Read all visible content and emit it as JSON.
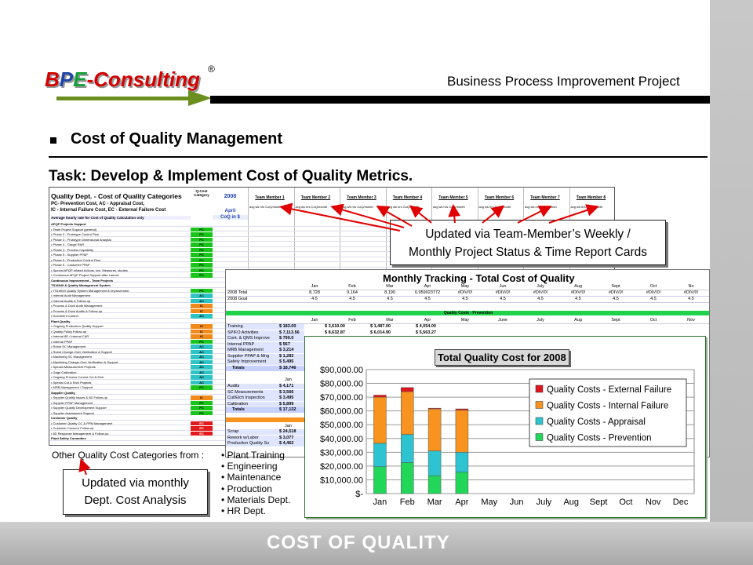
{
  "header": {
    "logo_b": "B",
    "logo_p": "P",
    "logo_e": "E",
    "logo_rest": "-Consulting",
    "registered": "®",
    "project_title": "Business Process Improvement Project"
  },
  "section": {
    "title": "Cost of Quality Management",
    "task": "Task: Develop & Implement Cost of Quality Metrics."
  },
  "sheet": {
    "title": "Quality Dept. - Cost of Quality Categories",
    "legend_line1": "PC- Prevention Cost,          AC - Appraisal Cost,",
    "legend_line2": "IC - Internal Failure Cost,    EC - External Failure Cost",
    "rate_line": "Average hourly rate for Cost of Quality Calculation only",
    "category_header": "Q-Cost Category",
    "year": "2008",
    "month": "April",
    "coq_label": "CoQ in $",
    "team_members": [
      "Team Member 1",
      "Team Member 2",
      "Team Member 3",
      "Team Member 4",
      "Team Member 5",
      "Team Member 6",
      "Team Member 7",
      "Team Member 8"
    ],
    "tm_sub": "avg wk hrs   CoQ/month",
    "rows": [
      {
        "label": "APQP Projects Support",
        "cat": "",
        "bold": true
      },
      {
        "label": "• Team Project Support (general)",
        "cat": "PC"
      },
      {
        "label": "• Phase 3 - Prototype Control Plan",
        "cat": "PC"
      },
      {
        "label": "• Phase 3 - Prototype Dimensional Analysis",
        "cat": "PC"
      },
      {
        "label": "• Phase 4 - Gauge R&R",
        "cat": "PC"
      },
      {
        "label": "• Phase 4 - Process Capability",
        "cat": "PC"
      },
      {
        "label": "• Phase 5 - Supplier PPAP",
        "cat": "PC"
      },
      {
        "label": "• Phase 5 - Production Control Plan",
        "cat": "PC"
      },
      {
        "label": "• Phase 5 - Customer PPAP",
        "cat": "PC"
      },
      {
        "label": "• Special APQP related Actions, incl. Measures, studies",
        "cat": "PC"
      },
      {
        "label": "• Continuous APQP Project Support after Launch",
        "cat": "PC"
      },
      {
        "label": "Continuous Improvement - Team Projects",
        "cat": "",
        "bold": true
      },
      {
        "label": "TS16949 & Quality Management System",
        "cat": "",
        "bold": true
      },
      {
        "label": "• TS16949 Quality System Management & Improvement",
        "cat": "PC"
      },
      {
        "label": "• Internal Audit Management",
        "cat": "AC"
      },
      {
        "label": "• Internal Audits & Follow-up",
        "cat": "AC"
      },
      {
        "label": "• Process & Dock Audit Management",
        "cat": "IC"
      },
      {
        "label": "• Process & Dock Audits & Follow-up",
        "cat": "IC"
      },
      {
        "label": "• Document Control",
        "cat": "AC"
      },
      {
        "label": "Plant Quality",
        "cat": "",
        "bold": true
      },
      {
        "label": "• Ongoing Production Quality Support",
        "cat": "IC"
      },
      {
        "label": "• Quality Policy Follow-up",
        "cat": "IC"
      },
      {
        "label": "• Internal 8D / Internal CAR",
        "cat": "IC"
      },
      {
        "label": "• Internal PPAP",
        "cat": "PC"
      },
      {
        "label": "• Robot SC Management",
        "cat": "AC"
      },
      {
        "label": "• Robot Change-Over Verification & Support",
        "cat": "AC"
      },
      {
        "label": "• Machining SC Management",
        "cat": "AC"
      },
      {
        "label": "• Machining Change-Over Verification & Support",
        "cat": "AC"
      },
      {
        "label": "• Special Measurement Projects",
        "cat": "AC"
      },
      {
        "label": "• Gage Calibration",
        "cat": "AC"
      },
      {
        "label": "• Ongoing Process Control Cut & Etch",
        "cat": "AC"
      },
      {
        "label": "• Special Cut & Etch Projects",
        "cat": "AC"
      },
      {
        "label": "• MRB Management / Support",
        "cat": "PC"
      },
      {
        "label": "Supplier Quality",
        "cat": "",
        "bold": true
      },
      {
        "label": "• Supplier Quality Issues & 8D Follow-up",
        "cat": "IC"
      },
      {
        "label": "• Supplier PPAP Management",
        "cat": "PC"
      },
      {
        "label": "• Supplier Quality Development Support",
        "cat": "PC"
      },
      {
        "label": "• Supplier Assessment Support",
        "cat": "PC"
      },
      {
        "label": "Customer Quality",
        "cat": "",
        "bold": true
      },
      {
        "label": "• Customer Quality CC & PPM Management",
        "cat": "EC"
      },
      {
        "label": "• Customer Concern Follow-up",
        "cat": "EC"
      },
      {
        "label": "• 8D Response Management & Follow-up",
        "cat": "EC"
      },
      {
        "label": "Plant Safety Committee",
        "cat": "",
        "bold": true
      }
    ]
  },
  "callout_top": {
    "line1": "Updated via Team-Member’s Weekly /",
    "line2": "Monthly Project Status & Time Report Cards"
  },
  "callout_bottom": {
    "line1": "Updated via monthly",
    "line2": "Dept. Cost Analysis"
  },
  "monthly": {
    "title": "Monthly Tracking - Total Cost of Quality",
    "months_header": [
      "Jan",
      "Feb",
      "Mar",
      "Apr",
      "May",
      "Jun",
      "July",
      "Aug",
      "Sept",
      "Oct",
      "No"
    ],
    "total_label": "2008 Total",
    "total_values": [
      "8,728",
      "9,164",
      "8,190",
      "6.959023772",
      "#DIV/0!",
      "#DIV/0!",
      "#DIV/0!",
      "#DIV/0!",
      "#DIV/0!",
      "#DIV/0!",
      "#DIV/0!"
    ],
    "goal_label": "2008 Goal",
    "goal_values": [
      "4.5",
      "4.5",
      "4.5",
      "4.5",
      "4.5",
      "4.5",
      "4.5",
      "4.5",
      "4.5",
      "4.5",
      "4.5"
    ],
    "prevention_bar": "Quality Costs - Prevention",
    "sub_months": [
      "Jan",
      "Feb",
      "Mar",
      "Apr",
      "May",
      "June",
      "July",
      "Aug",
      "Sept",
      "Oct",
      "Nov"
    ],
    "prevention_rows": [
      {
        "label": "Training",
        "values": [
          "$ 183.00",
          "$ 3,610.00",
          "$ 1,487.00",
          "$ 4,054.00"
        ]
      },
      {
        "label": "SPIFO Activities",
        "values": [
          "$ 7,113.56",
          "$ 8,632.87",
          "$ 6,014.90",
          "$ 5,563.27"
        ]
      },
      {
        "label": "Cont. & QMS Improve",
        "values": [
          "$ 790.0",
          "",
          "",
          ""
        ]
      },
      {
        "label": "Internal PPAP",
        "values": [
          "$ 567",
          "",
          "",
          ""
        ]
      },
      {
        "label": "MRB Management",
        "values": [
          "$ 3,214",
          "",
          "",
          ""
        ]
      },
      {
        "label": "Supplier PPAP & Mng",
        "values": [
          "$ 1,283",
          "",
          "",
          ""
        ]
      },
      {
        "label": "Safety Improvement",
        "values": [
          "$ 5,495",
          "",
          "",
          ""
        ]
      }
    ],
    "prevention_total": {
      "label": "Totals",
      "value": "$ 18,746"
    },
    "appraisal_rows": [
      {
        "label": "Audits",
        "value": "$ 4,171"
      },
      {
        "label": "SC Measurements",
        "value": "$ 3,566"
      },
      {
        "label": "Cut/Etch Inspection",
        "value": "$ 3,495"
      },
      {
        "label": "Calibration",
        "value": "$ 5,899"
      }
    ],
    "appraisal_total": {
      "label": "Totals",
      "value": "$ 17,132"
    },
    "internal_rows": [
      {
        "label": "Scrap",
        "value": "$ 24,518"
      },
      {
        "label": "Rework w/Labor",
        "value": "$ 3,077"
      },
      {
        "label": "Production Quality Su",
        "value": "$ 4,462"
      }
    ]
  },
  "chart_data": {
    "type": "bar",
    "stacked": true,
    "title": "Total Quality Cost for 2008",
    "categories": [
      "Jan",
      "Feb",
      "Mar",
      "Apr",
      "May",
      "Jun",
      "July",
      "Aug",
      "Sept",
      "Oct",
      "Nov",
      "Dec"
    ],
    "series": [
      {
        "name": "Quality Costs - Prevention",
        "color": "#22d65a",
        "values": [
          19500,
          22500,
          13000,
          15500,
          0,
          0,
          0,
          0,
          0,
          0,
          0,
          0
        ]
      },
      {
        "name": "Quality Costs - Appraisal",
        "color": "#2ec3d0",
        "values": [
          17000,
          20500,
          18000,
          14500,
          0,
          0,
          0,
          0,
          0,
          0,
          0,
          0
        ]
      },
      {
        "name": "Quality Costs - Internal Failure",
        "color": "#f7931e",
        "values": [
          33500,
          31000,
          30500,
          30500,
          0,
          0,
          0,
          0,
          0,
          0,
          0,
          0
        ]
      },
      {
        "name": "Quality Costs - External Failure",
        "color": "#e0141e",
        "values": [
          1500,
          3000,
          500,
          1000,
          0,
          0,
          0,
          0,
          0,
          0,
          0,
          0
        ]
      }
    ],
    "ylim": [
      0,
      90000
    ],
    "yticks": [
      "$-",
      "$10,000.00",
      "$20,000.00",
      "$30,000.00",
      "$40,000.00",
      "$50,000.00",
      "$60,000.00",
      "$70,000.00",
      "$80,000.00",
      "$90,000.00"
    ],
    "legend_order": [
      "Quality Costs - External Failure",
      "Quality Costs - Internal Failure",
      "Quality Costs - Appraisal",
      "Quality Costs - Prevention"
    ],
    "legend_position": "right",
    "grid": true
  },
  "other_categories": {
    "title": "Other Quality Cost Categories from :",
    "items": [
      "Plant Training",
      "Engineering",
      "Maintenance",
      "Production",
      "Materials Dept.",
      "HR Dept."
    ]
  },
  "footer": {
    "title": "COST OF QUALITY"
  }
}
